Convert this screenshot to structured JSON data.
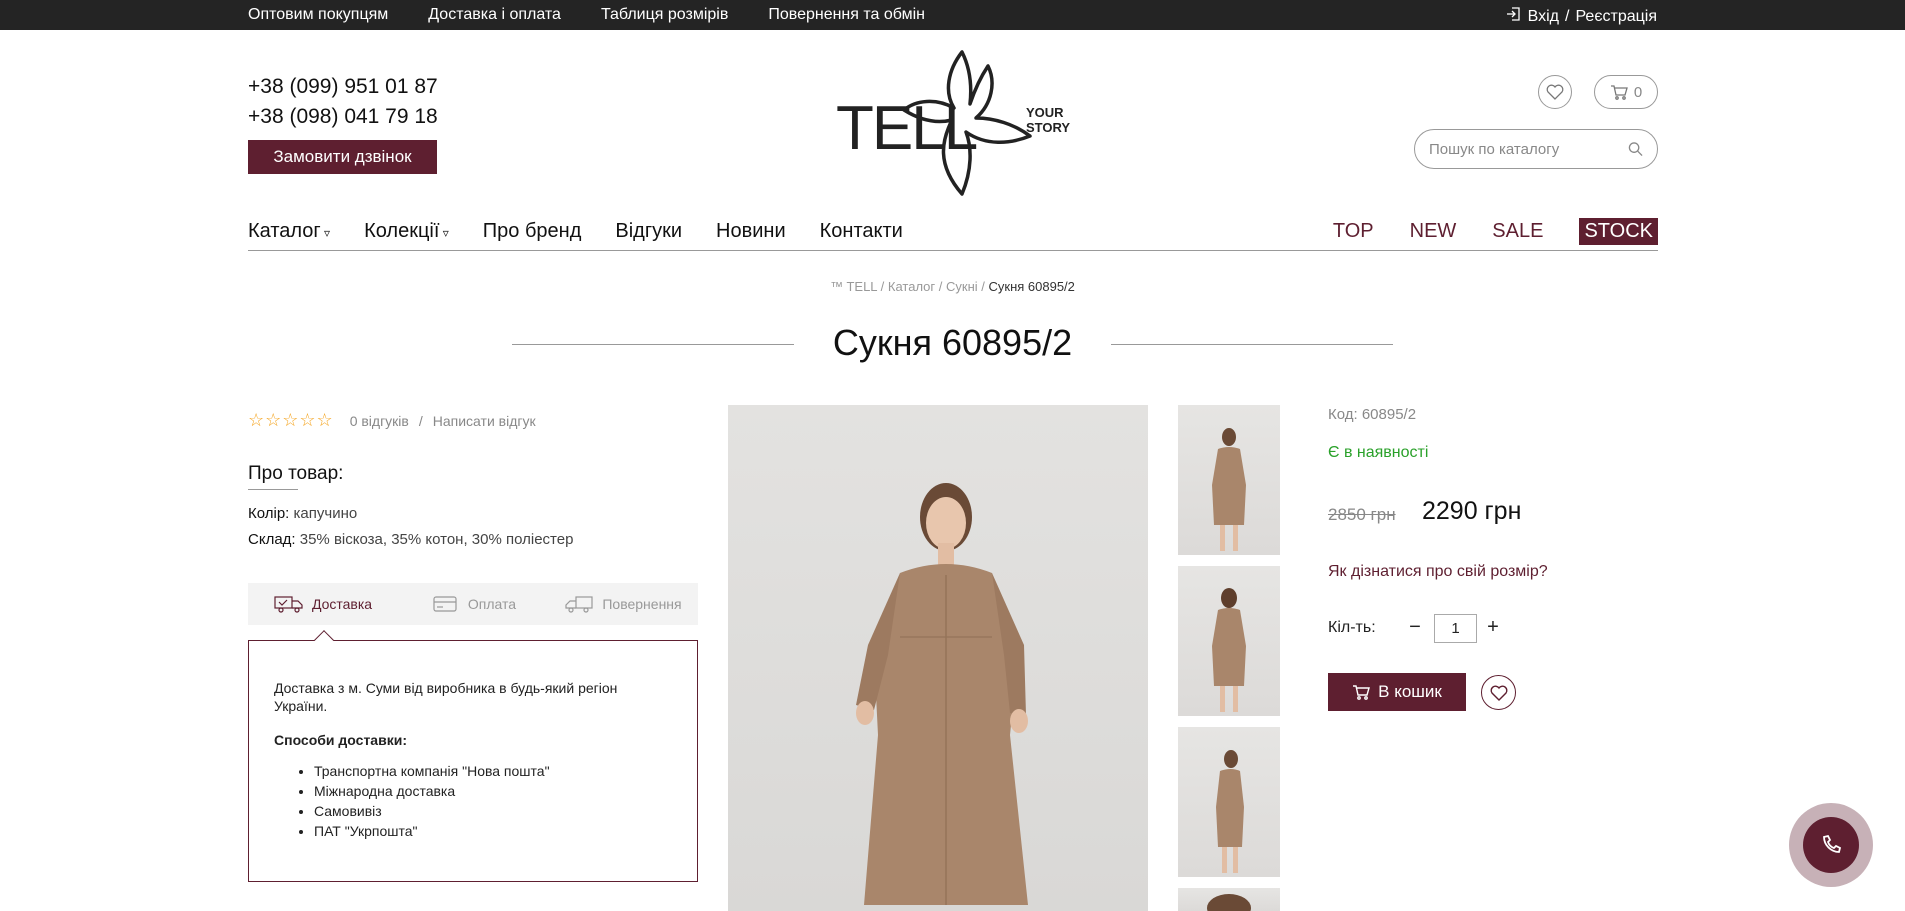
{
  "topbar": {
    "links": [
      "Оптовим покупцям",
      "Доставка і оплата",
      "Таблиця розмірів",
      "Повернення та обмін"
    ],
    "login": "Вхід",
    "separator": "/",
    "register": "Реєстрація"
  },
  "header": {
    "phones": [
      "+38 (099) 951 01 87",
      "+38 (098) 041 79 18"
    ],
    "call_button": "Замовити дзвінок",
    "logo_text": "TELL",
    "logo_tagline_1": "YOUR",
    "logo_tagline_2": "STORY",
    "cart_count": "0",
    "search_placeholder": "Пошук по каталогу"
  },
  "nav": {
    "left": [
      {
        "label": "Каталог",
        "dropdown": true
      },
      {
        "label": "Колекції",
        "dropdown": true
      },
      {
        "label": "Про бренд"
      },
      {
        "label": "Відгуки"
      },
      {
        "label": "Новини"
      },
      {
        "label": "Контакти"
      }
    ],
    "right": [
      "TOP",
      "NEW",
      "SALE",
      "STOCK"
    ]
  },
  "breadcrumb": {
    "items": [
      "™ TELL",
      "Каталог",
      "Сукні"
    ],
    "current": "Сукня 60895/2"
  },
  "product": {
    "title": "Сукня 60895/2",
    "rating": {
      "stars": 0,
      "max": 5,
      "reviews": "0 відгуків",
      "separator": "/",
      "write": "Написати відгук"
    },
    "about_title": "Про товар:",
    "attributes": [
      {
        "label": "Колір:",
        "value": "капучино"
      },
      {
        "label": "Склад:",
        "value": "35% віскоза, 35% котон, 30% поліестер"
      }
    ],
    "tabs": [
      "Доставка",
      "Оплата",
      "Повернення"
    ],
    "delivery": {
      "intro": "Доставка з м. Суми від виробника в будь-який регіон України.",
      "methods_title": "Способи доставки:",
      "methods": [
        "Транспортна компанія \"Нова пошта\"",
        "Міжнародна доставка",
        "Самовивіз",
        "ПАТ \"Укрпошта\""
      ]
    },
    "code": "Код: 60895/2",
    "availability": "Є в наявності",
    "old_price": "2850 грн",
    "price": "2290 грн",
    "size_link": "Як дізнатися про свій розмір?",
    "qty_label": "Кіл-ть:",
    "qty_minus": "−",
    "qty_value": "1",
    "qty_plus": "+",
    "add_to_cart": "В кошик"
  },
  "colors": {
    "brand": "#5e1f30",
    "topbar": "#242424",
    "in_stock": "#2aa12a",
    "star": "#f5a623",
    "dress": "#a9866b"
  }
}
